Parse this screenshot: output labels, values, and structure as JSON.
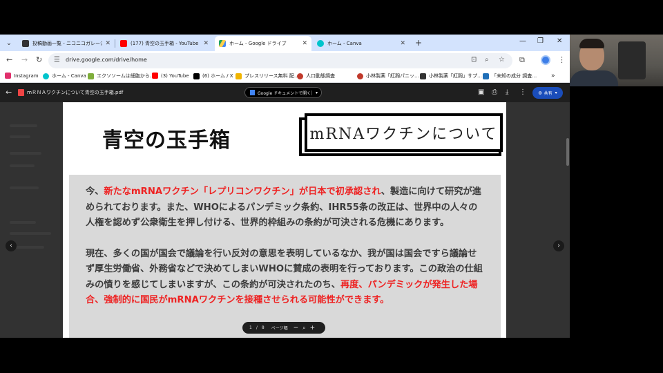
{
  "tabs": [
    {
      "label": "投稿動画一覧 - ニコニコガレージ",
      "color": "#333333"
    },
    {
      "label": "(177) 青空の玉手箱 - YouTube",
      "color": "#ff0000"
    },
    {
      "label": "ホーム - Google ドライブ",
      "color": "#1fa463"
    },
    {
      "label": "ホーム - Canva",
      "color": "#00c4cc"
    }
  ],
  "address_bar": {
    "url": "drive.google.com/drive/home"
  },
  "bookmarks": [
    {
      "label": "Instagram",
      "color": "#e1306c"
    },
    {
      "label": "ホーム - Canva",
      "color": "#00c4cc"
    },
    {
      "label": "エクソソームは細胞から…",
      "color": "#7fae3b"
    },
    {
      "label": "(3) YouTube",
      "color": "#ff0000"
    },
    {
      "label": "(6) ホーム / X",
      "color": "#000000"
    },
    {
      "label": "プレスリリース無料 配…",
      "color": "#f0b400"
    },
    {
      "label": "人口動態調査 ",
      "color": "#c0392b"
    },
    {
      "label": "小林製薬「紅麹パニッ…",
      "color": "#c0392b"
    },
    {
      "label": "小林製薬「紅麹」サプ…",
      "color": "#333333"
    },
    {
      "label": "「未知の成分 調査…",
      "color": "#1f6fb8"
    }
  ],
  "viewer": {
    "file_name": "ｍＲＮＡワクチンについて青空の玉手箱.pdf",
    "open_with": "Google ドキュメントで開く",
    "share": "共有"
  },
  "document": {
    "title": "青空の玉手箱",
    "subtitle": "mRNAワクチンについて",
    "p1": {
      "a": "今、",
      "red": "新たなmRNAワクチン「レプリコンワクチン」が日本で初承認され",
      "b": "、製造に向けて研究が進められております。また、WHOによるパンデミック条約、IHR55条の改正は、世界中の人々の人権を認めず公衆衛生を押し付ける、世界的枠組みの条約が可決される危機にあります。"
    },
    "p2": {
      "a": "現在、多くの国が国会で議論を行い反対の意思を表明しているなか、我が国は国会ですら議論せず厚生労働省、外務省などで決めてしまいWHOに賛成の表明を行っております。この政治の仕組みの憤りを感じてしまいますが、この条約が可決されたのち、",
      "red": "再度、パンデミックが発生した場合、強制的に国民がmRNAワクチンを接種させられる可能性ができます。"
    }
  },
  "page_nav": {
    "current": "1",
    "separator": "/",
    "total": "8",
    "label": "ページ幅"
  }
}
